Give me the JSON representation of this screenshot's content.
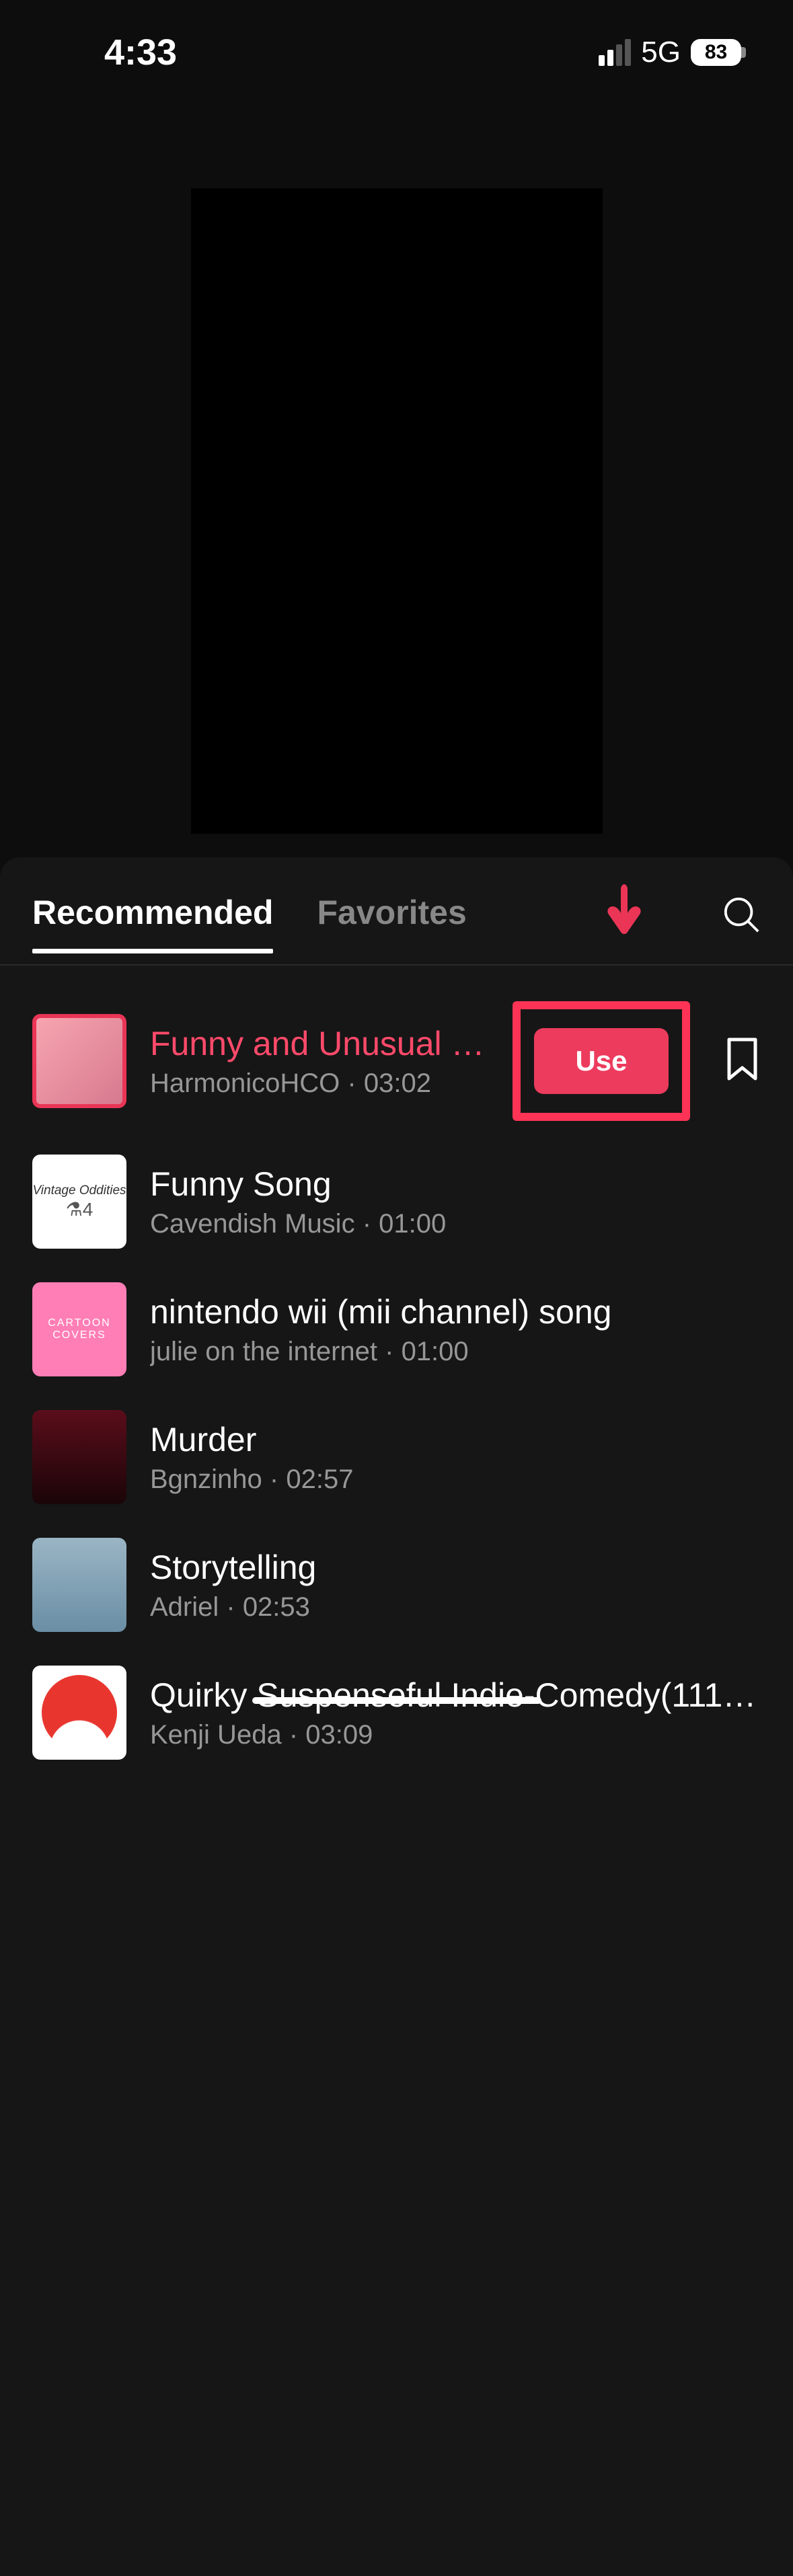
{
  "status": {
    "time": "4:33",
    "network": "5G",
    "battery": "83"
  },
  "tabs": {
    "recommended": "Recommended",
    "favorites": "Favorites"
  },
  "use_button_label": "Use",
  "sounds": [
    {
      "title": "Funny and Unusual S…",
      "artist": "HarmonicoHCO",
      "duration": "03:02",
      "playing": true,
      "selected": true,
      "show_use": true
    },
    {
      "title": "Funny Song",
      "artist": "Cavendish Music",
      "duration": "01:00"
    },
    {
      "title": "nintendo wii (mii channel) song",
      "artist": "julie on the internet",
      "duration": "01:00"
    },
    {
      "title": "Murder",
      "artist": "Bgnzinho",
      "duration": "02:57"
    },
    {
      "title": "Storytelling",
      "artist": "Adriel",
      "duration": "02:53"
    },
    {
      "title": "Quirky Suspenseful Indie-Comedy(111…",
      "artist": "Kenji Ueda",
      "duration": "03:09"
    }
  ]
}
